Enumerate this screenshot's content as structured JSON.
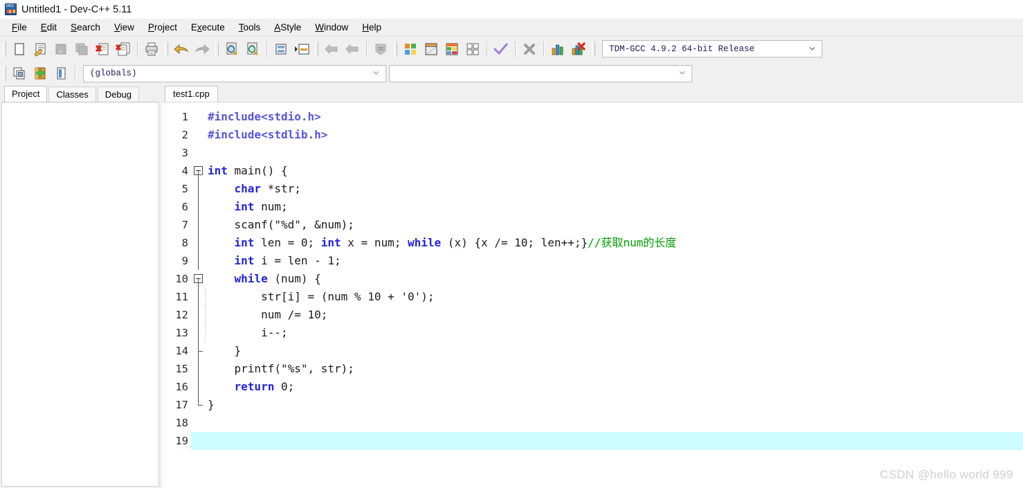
{
  "window": {
    "title": "Untitled1 - Dev-C++ 5.11",
    "icon": "devcpp-logo-icon"
  },
  "menubar": {
    "items": [
      {
        "label": "File",
        "accel": "F"
      },
      {
        "label": "Edit",
        "accel": "E"
      },
      {
        "label": "Search",
        "accel": "S"
      },
      {
        "label": "View",
        "accel": "V"
      },
      {
        "label": "Project",
        "accel": "P"
      },
      {
        "label": "Execute",
        "accel": "x"
      },
      {
        "label": "Tools",
        "accel": "T"
      },
      {
        "label": "AStyle",
        "accel": "A"
      },
      {
        "label": "Window",
        "accel": "W"
      },
      {
        "label": "Help",
        "accel": "H"
      }
    ]
  },
  "toolbar": {
    "buttons": [
      {
        "name": "new-file-button",
        "enabled": true
      },
      {
        "name": "open-file-button",
        "enabled": true
      },
      {
        "name": "save-file-button",
        "enabled": false
      },
      {
        "name": "save-all-button",
        "enabled": false
      },
      {
        "name": "close-file-button",
        "enabled": true
      },
      {
        "name": "close-all-button",
        "enabled": true
      },
      {
        "name": "print-button",
        "enabled": true
      },
      {
        "name": "undo-button",
        "enabled": true
      },
      {
        "name": "redo-button",
        "enabled": false
      },
      {
        "name": "find-button",
        "enabled": true
      },
      {
        "name": "replace-button",
        "enabled": true
      },
      {
        "name": "goto-line-button",
        "enabled": true
      },
      {
        "name": "goto-function-button",
        "enabled": true
      },
      {
        "name": "back-button",
        "enabled": false
      },
      {
        "name": "forward-button",
        "enabled": false
      },
      {
        "name": "toggle-bookmark-button",
        "enabled": false
      },
      {
        "name": "compile-button",
        "enabled": true
      },
      {
        "name": "run-button",
        "enabled": true
      },
      {
        "name": "compile-run-button",
        "enabled": true
      },
      {
        "name": "rebuild-all-button",
        "enabled": true
      },
      {
        "name": "syntax-check-button",
        "enabled": true
      },
      {
        "name": "stop-execution-button",
        "enabled": false
      },
      {
        "name": "profile-button",
        "enabled": true
      },
      {
        "name": "delete-profile-button",
        "enabled": true
      }
    ],
    "compiler_select": {
      "value": "TDM-GCC 4.9.2 64-bit Release",
      "chevron": "chevron-down-icon"
    }
  },
  "toolbar2": {
    "buttons": [
      {
        "name": "insert-snippet-button"
      },
      {
        "name": "add-to-project-button"
      },
      {
        "name": "toggle-panel-button"
      }
    ],
    "scope_select": {
      "value": "(globals)",
      "chevron": "chevron-down-icon"
    },
    "member_select": {
      "value": "",
      "chevron": "chevron-down-icon"
    }
  },
  "left_panel": {
    "tabs": [
      {
        "label": "Project",
        "active": true
      },
      {
        "label": "Classes",
        "active": false
      },
      {
        "label": "Debug",
        "active": false
      }
    ]
  },
  "editor": {
    "tabs": [
      {
        "label": "test1.cpp",
        "active": true
      }
    ],
    "active_line": 19,
    "colors": {
      "keyword": "#2222dd",
      "preprocessor": "#5555dd",
      "comment": "#00a000",
      "plain": "#1a1a1a",
      "active_line_bg": "#ccfcff"
    },
    "lines": [
      {
        "n": 1,
        "fold": "none",
        "indent_guide": false,
        "tokens": [
          {
            "t": "#include<stdio.h>",
            "c": "pp"
          }
        ]
      },
      {
        "n": 2,
        "fold": "none",
        "indent_guide": false,
        "tokens": [
          {
            "t": "#include<stdlib.h>",
            "c": "pp"
          }
        ]
      },
      {
        "n": 3,
        "fold": "none",
        "indent_guide": false,
        "tokens": []
      },
      {
        "n": 4,
        "fold": "open",
        "indent_guide": false,
        "tokens": [
          {
            "t": "int",
            "c": "kw"
          },
          {
            "t": " main() {",
            "c": "pl"
          }
        ]
      },
      {
        "n": 5,
        "fold": "line",
        "indent_guide": false,
        "tokens": [
          {
            "t": "    ",
            "c": "pl"
          },
          {
            "t": "char",
            "c": "kw"
          },
          {
            "t": " *str;",
            "c": "pl"
          }
        ]
      },
      {
        "n": 6,
        "fold": "line",
        "indent_guide": false,
        "tokens": [
          {
            "t": "    ",
            "c": "pl"
          },
          {
            "t": "int",
            "c": "kw"
          },
          {
            "t": " num;",
            "c": "pl"
          }
        ]
      },
      {
        "n": 7,
        "fold": "line",
        "indent_guide": false,
        "tokens": [
          {
            "t": "    scanf(\"%d\", &num);",
            "c": "pl"
          }
        ]
      },
      {
        "n": 8,
        "fold": "line",
        "indent_guide": false,
        "tokens": [
          {
            "t": "    ",
            "c": "pl"
          },
          {
            "t": "int",
            "c": "kw"
          },
          {
            "t": " len = 0; ",
            "c": "pl"
          },
          {
            "t": "int",
            "c": "kw"
          },
          {
            "t": " x = num; ",
            "c": "pl"
          },
          {
            "t": "while",
            "c": "kw"
          },
          {
            "t": " (x) {x /= 10; len++;}",
            "c": "pl"
          },
          {
            "t": "//获取num的长度",
            "c": "cm"
          }
        ]
      },
      {
        "n": 9,
        "fold": "line",
        "indent_guide": false,
        "tokens": [
          {
            "t": "    ",
            "c": "pl"
          },
          {
            "t": "int",
            "c": "kw"
          },
          {
            "t": " i = len - 1;",
            "c": "pl"
          }
        ]
      },
      {
        "n": 10,
        "fold": "open2",
        "indent_guide": false,
        "tokens": [
          {
            "t": "    ",
            "c": "pl"
          },
          {
            "t": "while",
            "c": "kw"
          },
          {
            "t": " (num) {",
            "c": "pl"
          }
        ]
      },
      {
        "n": 11,
        "fold": "line",
        "indent_guide": true,
        "tokens": [
          {
            "t": "        str[i] = (num % 10 + '0');",
            "c": "pl"
          }
        ]
      },
      {
        "n": 12,
        "fold": "line",
        "indent_guide": true,
        "tokens": [
          {
            "t": "        num /= 10;",
            "c": "pl"
          }
        ]
      },
      {
        "n": 13,
        "fold": "line",
        "indent_guide": true,
        "tokens": [
          {
            "t": "        i--;",
            "c": "pl"
          }
        ]
      },
      {
        "n": 14,
        "fold": "end2",
        "indent_guide": false,
        "tokens": [
          {
            "t": "    }",
            "c": "pl"
          }
        ]
      },
      {
        "n": 15,
        "fold": "line",
        "indent_guide": false,
        "tokens": [
          {
            "t": "    printf(\"%s\", str);",
            "c": "pl"
          }
        ]
      },
      {
        "n": 16,
        "fold": "line",
        "indent_guide": false,
        "tokens": [
          {
            "t": "    ",
            "c": "pl"
          },
          {
            "t": "return",
            "c": "kw"
          },
          {
            "t": " 0;",
            "c": "pl"
          }
        ]
      },
      {
        "n": 17,
        "fold": "end",
        "indent_guide": false,
        "tokens": [
          {
            "t": "}",
            "c": "pl"
          }
        ]
      },
      {
        "n": 18,
        "fold": "none",
        "indent_guide": false,
        "tokens": []
      },
      {
        "n": 19,
        "fold": "none",
        "indent_guide": false,
        "tokens": []
      }
    ]
  },
  "watermark": {
    "text": "CSDN @hello world 999"
  }
}
